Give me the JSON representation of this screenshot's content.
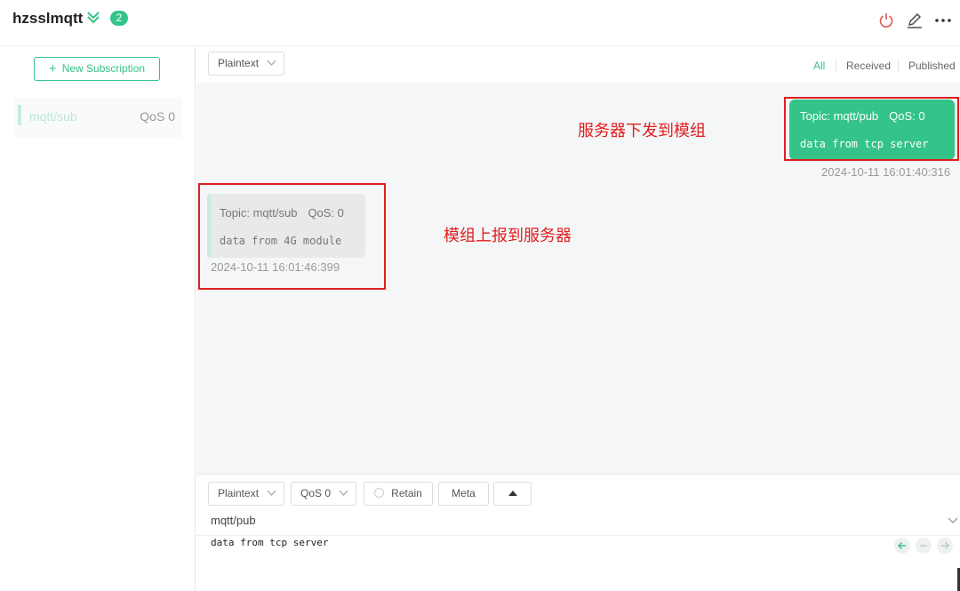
{
  "header": {
    "connection_name": "hzsslmqtt",
    "connection_count": "2",
    "icons": [
      "chevrons-down-icon",
      "power-icon",
      "edit-icon",
      "more-icon"
    ]
  },
  "sidebar": {
    "new_subscription_label": "New Subscription",
    "subscriptions": [
      {
        "topic": "mqtt/sub",
        "qos": "QoS 0"
      }
    ]
  },
  "toolbar": {
    "format_select": "Plaintext",
    "filter_tabs": [
      "All",
      "Received",
      "Published"
    ],
    "active_filter": "All"
  },
  "messages": [
    {
      "direction": "published",
      "topic": "Topic: mqtt/pub",
      "qos": "QoS: 0",
      "payload": "data from tcp server",
      "time": "2024-10-11 16:01:40:316"
    },
    {
      "direction": "received",
      "topic": "Topic: mqtt/sub",
      "qos": "QoS: 0",
      "payload": "data from 4G module",
      "time": "2024-10-11 16:01:46:399"
    }
  ],
  "annotations": {
    "published_note": "服务器下发到模组",
    "received_note": "模组上报到服务器"
  },
  "composer": {
    "format_select": "Plaintext",
    "qos_select": "QoS 0",
    "retain_label": "Retain",
    "meta_label": "Meta",
    "topic_value": "mqtt/pub",
    "payload_value": "data from tcp server"
  },
  "colors": {
    "accent": "#34c388",
    "annotation": "#e01e1e",
    "message_area": "#f5f6f7"
  }
}
